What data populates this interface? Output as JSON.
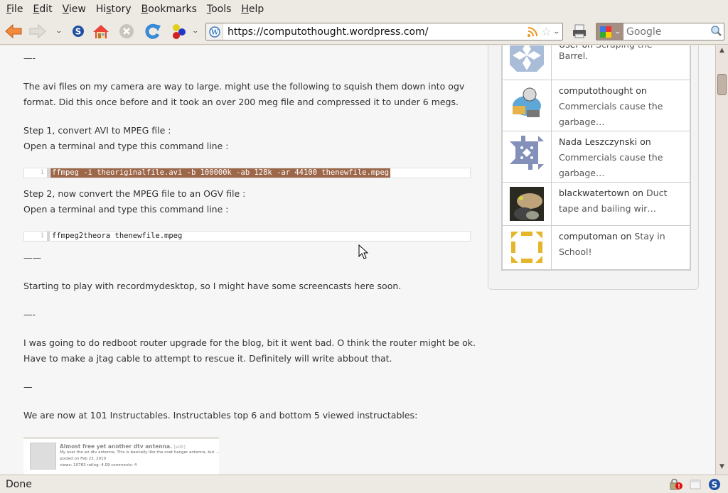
{
  "menu": [
    {
      "label": "File",
      "accel": "F",
      "rest": "ile"
    },
    {
      "label": "Edit",
      "accel": "E",
      "rest": "dit"
    },
    {
      "label": "View",
      "accel": "V",
      "rest": "iew"
    },
    {
      "label": "History",
      "pre": "Hi",
      "accel": "s",
      "rest": "tory"
    },
    {
      "label": "Bookmarks",
      "accel": "B",
      "rest": "ookmarks"
    },
    {
      "label": "Tools",
      "accel": "T",
      "rest": "ools"
    },
    {
      "label": "Help",
      "accel": "H",
      "rest": "elp"
    }
  ],
  "toolbar": {
    "back": "back-arrow-icon",
    "forward": "forward-arrow-icon",
    "history_dropdown": "chevron-down-icon",
    "stumble": "stumbleupon-icon",
    "home": "home-icon",
    "stop": "stop-icon",
    "reload": "reload-icon",
    "addon": "colored-balls-icon",
    "addon_dropdown": "chevron-down-icon",
    "url": "https://computothought.wordpress.com/",
    "url_site_icon": "wordpress-icon",
    "feed_icon": "rss-icon",
    "bookmark_star": "star-icon",
    "url_dropdown": "chevron-down-icon",
    "print": "printer-icon",
    "search_placeholder": "Google",
    "search_engine": "google-icon",
    "search_button": "magnifier-icon"
  },
  "article": {
    "dash1": "—-",
    "para1_line1": "The avi files on my camera are way to large. might use the following to squish them down into ogv",
    "para1_line2": "format. Did this once before and it took an over 200 meg file and compressed it to under 6 megs.",
    "step1_line1": "Step 1, convert AVI to MPEG file :",
    "step1_line2": "Open a terminal and type this command line :",
    "code1_line_no": "1",
    "code1": "ffmpeg -i theoriginalfile.avi -b 100000k -ab 128k -ar 44100 thenewfile.mpeg",
    "step2_line1": "Step 2, now convert the MPEG file to an OGV file :",
    "step2_line2": "Open a terminal and type this command line :",
    "code2_line_no": "1",
    "code2": "ffmpeg2theora thenewfile.mpeg",
    "dash2": "——",
    "para2": "Starting to play with recordmydesktop, so I might have some screencasts here soon.",
    "dash3": "—-",
    "para3_line1": "I was going to do redboot router upgrade for the blog, bit it went bad. O think the router might be ok.",
    "para3_line2": "Have to make a jtag cable to attempt to rescue it. Definitely will write abbout that.",
    "dash4": "—",
    "para4": "We are now at 101 Instructables. Instructables top 6 and bottom 5 viewed instructables:"
  },
  "embed": {
    "title": "Almost free yet another dtv antenna.",
    "edit": "[edit]",
    "desc": "My over the air dtv antenna. This is basically like the coat hanger antenna, but ...",
    "posted": "posted on Feb 23, 2010",
    "stats": "views: 10783 rating: 4.09 comments: 4"
  },
  "comments": [
    {
      "author": "User",
      "on": "on",
      "post": "Scraping the Barrel.",
      "avatar": "identicon-blue-avatar"
    },
    {
      "author": "computothought",
      "on": "on",
      "post": "Commercials cause the garbage…",
      "avatar": "cartoon-avatar"
    },
    {
      "author": "Nada Leszczynski",
      "on": "on",
      "post": "Commercials cause the garbage…",
      "avatar": "identicon-slate-avatar"
    },
    {
      "author": "blackwatertown",
      "on": "on",
      "post": "Duct tape and bailing wir…",
      "avatar": "photo-avatar"
    },
    {
      "author": "computoman",
      "on": "on",
      "post": "Stay in School!",
      "avatar": "identicon-yellow-avatar"
    }
  ],
  "status": {
    "text": "Done",
    "icons": [
      "insecure-lock-icon",
      "window-icon",
      "stumbleupon-icon"
    ]
  },
  "colors": {
    "code_highlight": "#9c6649",
    "chrome": "#ede9e3",
    "page_bg": "#f6f6f6"
  }
}
